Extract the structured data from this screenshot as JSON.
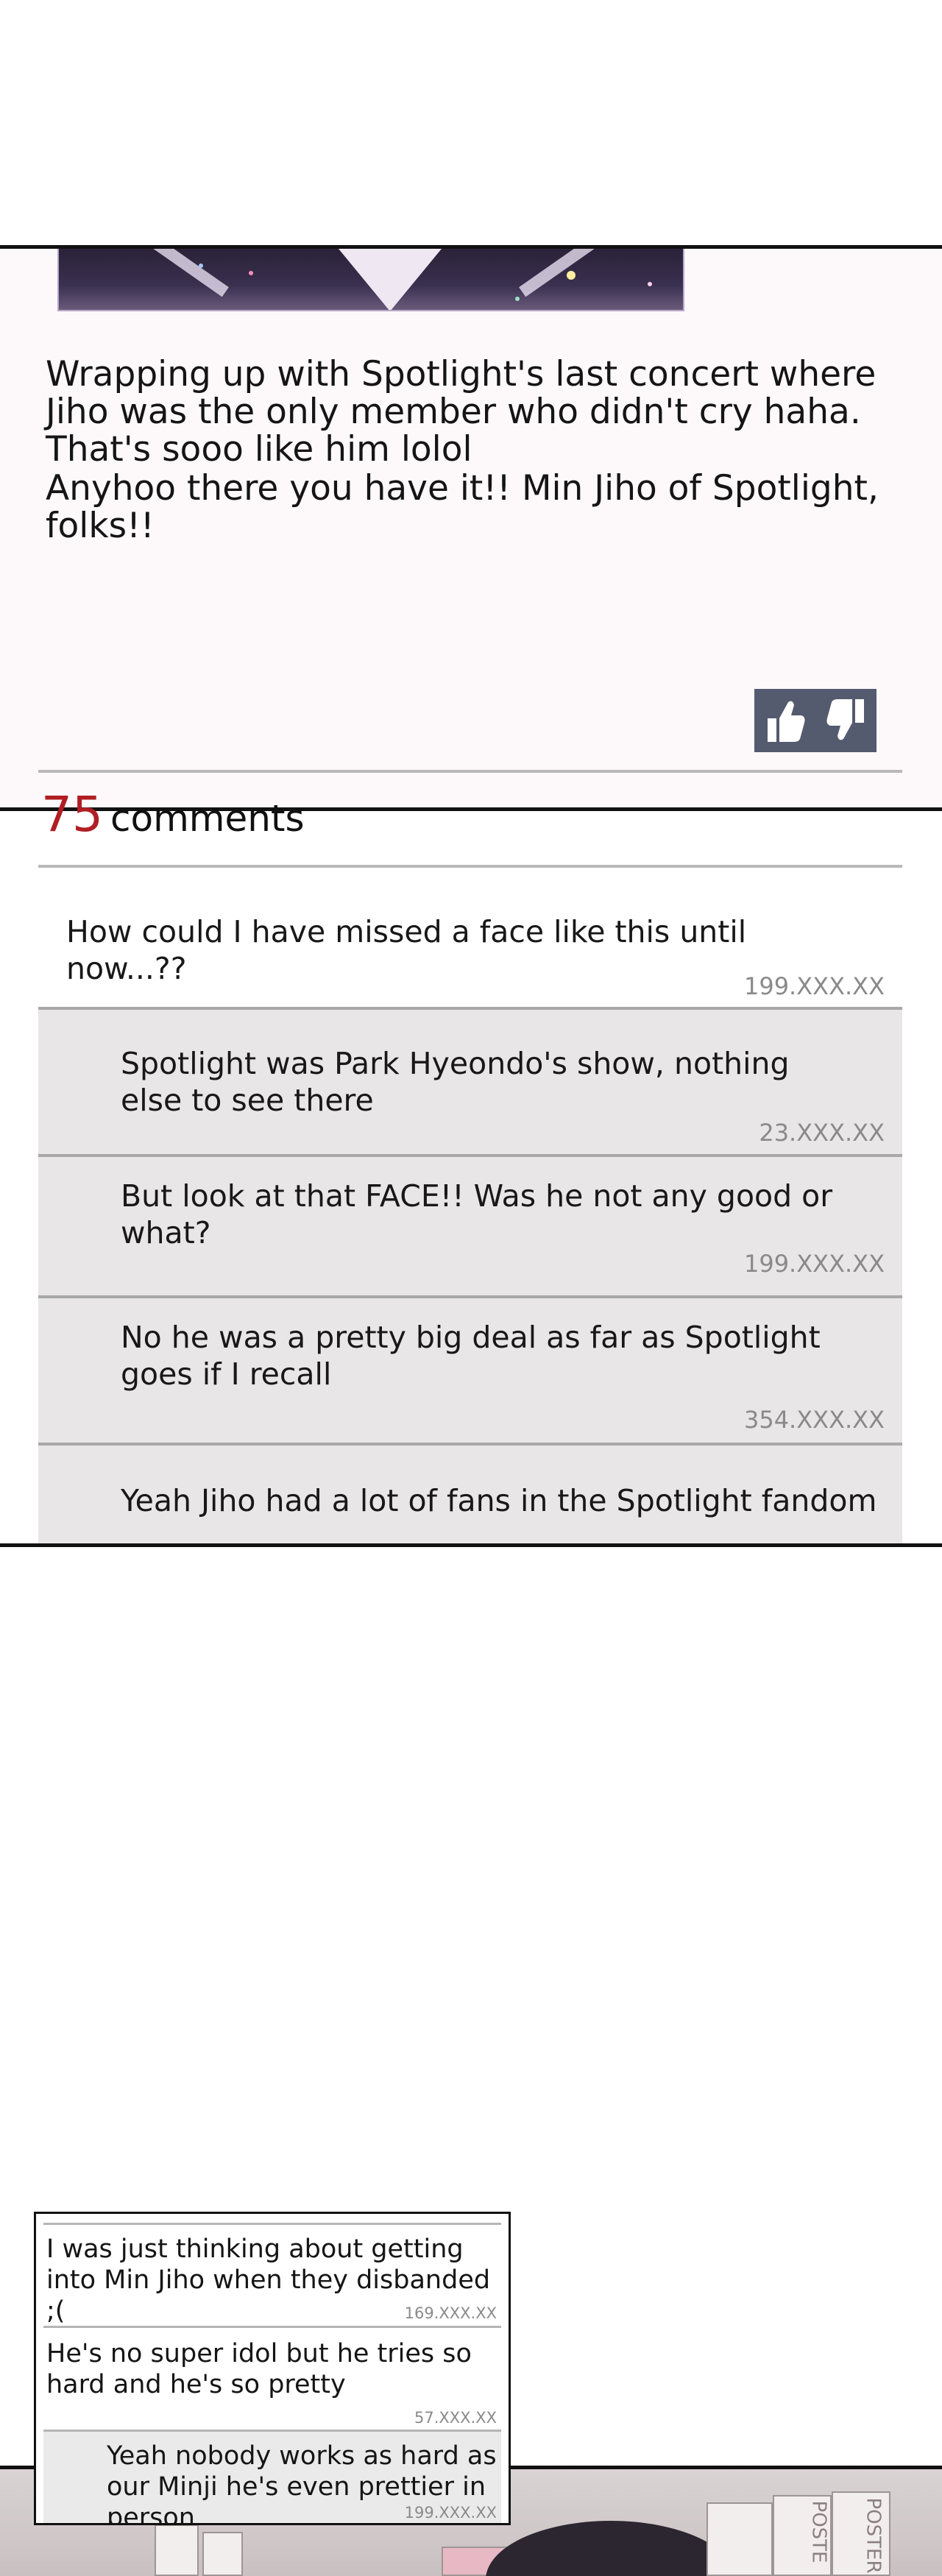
{
  "post": {
    "paragraph_1": "Wrapping up with Spotlight's last concert where Jiho was the only member who didn't cry haha. That's sooo like him lolol",
    "paragraph_2": "Anyhoo there you have it!! Min Jiho of Spotlight, folks!!"
  },
  "votes": {
    "like_icon": "thumbs-up-icon",
    "dislike_icon": "thumbs-down-icon"
  },
  "comments_header": {
    "count": "75",
    "label": "comments"
  },
  "comments": [
    {
      "text": "How could I have missed a face like this until now...??",
      "ip": "199.XXX.XX"
    },
    {
      "text": "Spotlight was Park Hyeondo's show, nothing else to see there",
      "ip": "23.XXX.XX"
    },
    {
      "text": "But look at that FACE!! Was he not any good or what?",
      "ip": "199.XXX.XX"
    },
    {
      "text": "No he was a pretty big deal as far as Spotlight goes if I recall",
      "ip": "354.XXX.XX"
    },
    {
      "text": "Yeah Jiho had a lot of fans in the Spotlight fandom",
      "ip": ""
    }
  ],
  "inset_comments": [
    {
      "text": "I was just thinking about getting into Min Jiho when they disbanded ;(",
      "ip": "169.XXX.XX"
    },
    {
      "text": "He's no super idol but he tries so hard and he's so pretty",
      "ip": "57.XXX.XX"
    },
    {
      "text": "Yeah nobody works as hard as our Minji he's even prettier in person",
      "ip": "199.XXX.XX"
    }
  ],
  "background_labels": {
    "poster_1": "POSTE",
    "poster_2": "POSTER"
  },
  "colors": {
    "comment_count": "#b01e24",
    "vote_box": "#555b6e",
    "reply_bg": "#e8e6e7"
  }
}
